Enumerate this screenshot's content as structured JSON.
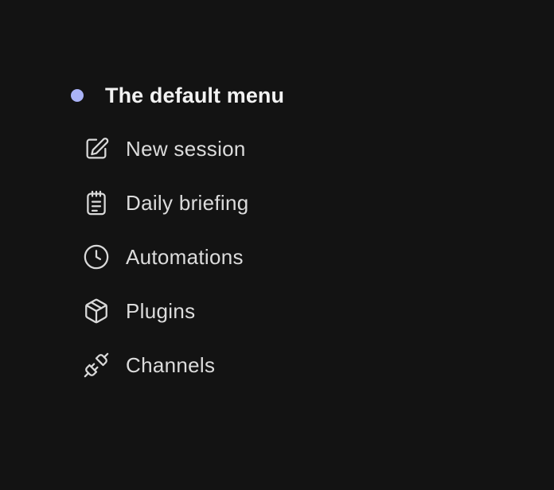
{
  "menu": {
    "title": "The default menu",
    "accent_color": "#aab3f7",
    "items": [
      {
        "label": "New session",
        "icon": "edit-icon"
      },
      {
        "label": "Daily briefing",
        "icon": "notepad-icon"
      },
      {
        "label": "Automations",
        "icon": "clock-icon"
      },
      {
        "label": "Plugins",
        "icon": "package-icon"
      },
      {
        "label": "Channels",
        "icon": "plug-icon"
      }
    ]
  }
}
